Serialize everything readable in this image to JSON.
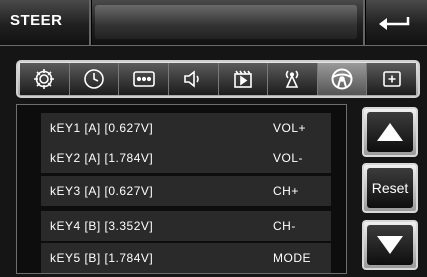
{
  "header": {
    "title": "STEER",
    "back_icon": "return-arrow-icon"
  },
  "tabs": [
    {
      "icon": "gear-icon",
      "active": false
    },
    {
      "icon": "clock-icon",
      "active": false
    },
    {
      "icon": "keypad-icon",
      "active": false
    },
    {
      "icon": "speaker-icon",
      "active": false
    },
    {
      "icon": "video-icon",
      "active": false
    },
    {
      "icon": "antenna-icon",
      "active": false
    },
    {
      "icon": "steering-wheel-icon",
      "active": true
    },
    {
      "icon": "add-icon",
      "active": false
    }
  ],
  "keys": [
    {
      "label": "kEY1  [A]  [0.627V]",
      "function": "VOL+"
    },
    {
      "label": "kEY2  [A]  [1.784V]",
      "function": "VOL-"
    },
    {
      "label": "kEY3  [A]  [0.627V]",
      "function": "CH+"
    },
    {
      "label": "kEY4  [B]  [3.352V]",
      "function": "CH-"
    },
    {
      "label": "kEY5  [B]  [1.784V]",
      "function": "MODE"
    }
  ],
  "side": {
    "up_icon": "up-arrow-icon",
    "reset_label": "Reset",
    "down_icon": "down-arrow-icon"
  }
}
